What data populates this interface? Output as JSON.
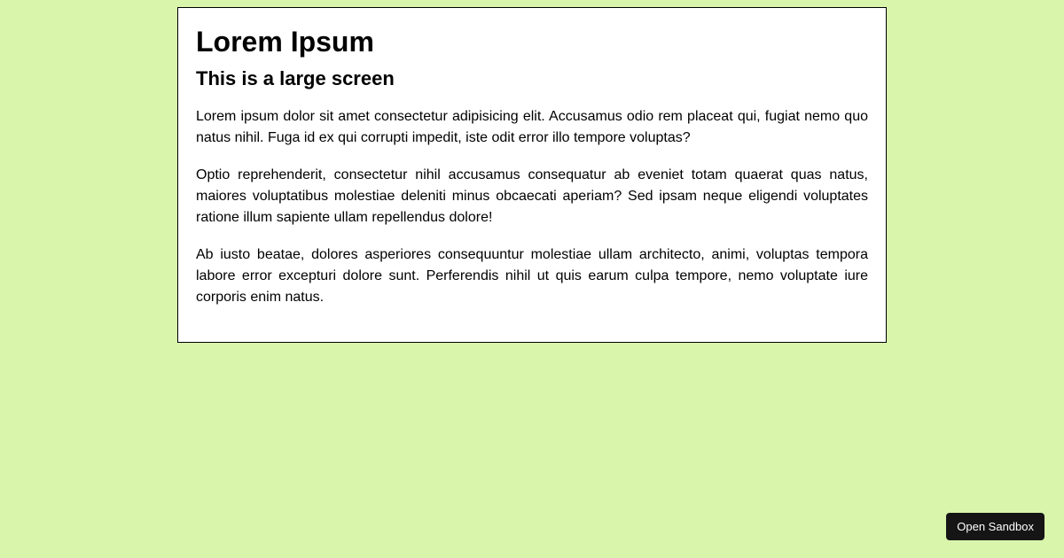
{
  "card": {
    "title": "Lorem Ipsum",
    "subtitle": "This is a large screen",
    "paragraphs": [
      "Lorem ipsum dolor sit amet consectetur adipisicing elit. Accusamus odio rem placeat qui, fugiat nemo quo natus nihil. Fuga id ex qui corrupti impedit, iste odit error illo tempore voluptas?",
      "Optio reprehenderit, consectetur nihil accusamus consequatur ab eveniet totam quaerat quas natus, maiores voluptatibus molestiae deleniti minus obcaecati aperiam? Sed ipsam neque eligendi voluptates ratione illum sapiente ullam repellendus dolore!",
      "Ab iusto beatae, dolores asperiores consequuntur molestiae ullam architecto, animi, voluptas tempora labore error excepturi dolore sunt. Perferendis nihil ut quis earum culpa tempore, nemo voluptate iure corporis enim natus."
    ]
  },
  "button": {
    "label": "Open Sandbox"
  }
}
